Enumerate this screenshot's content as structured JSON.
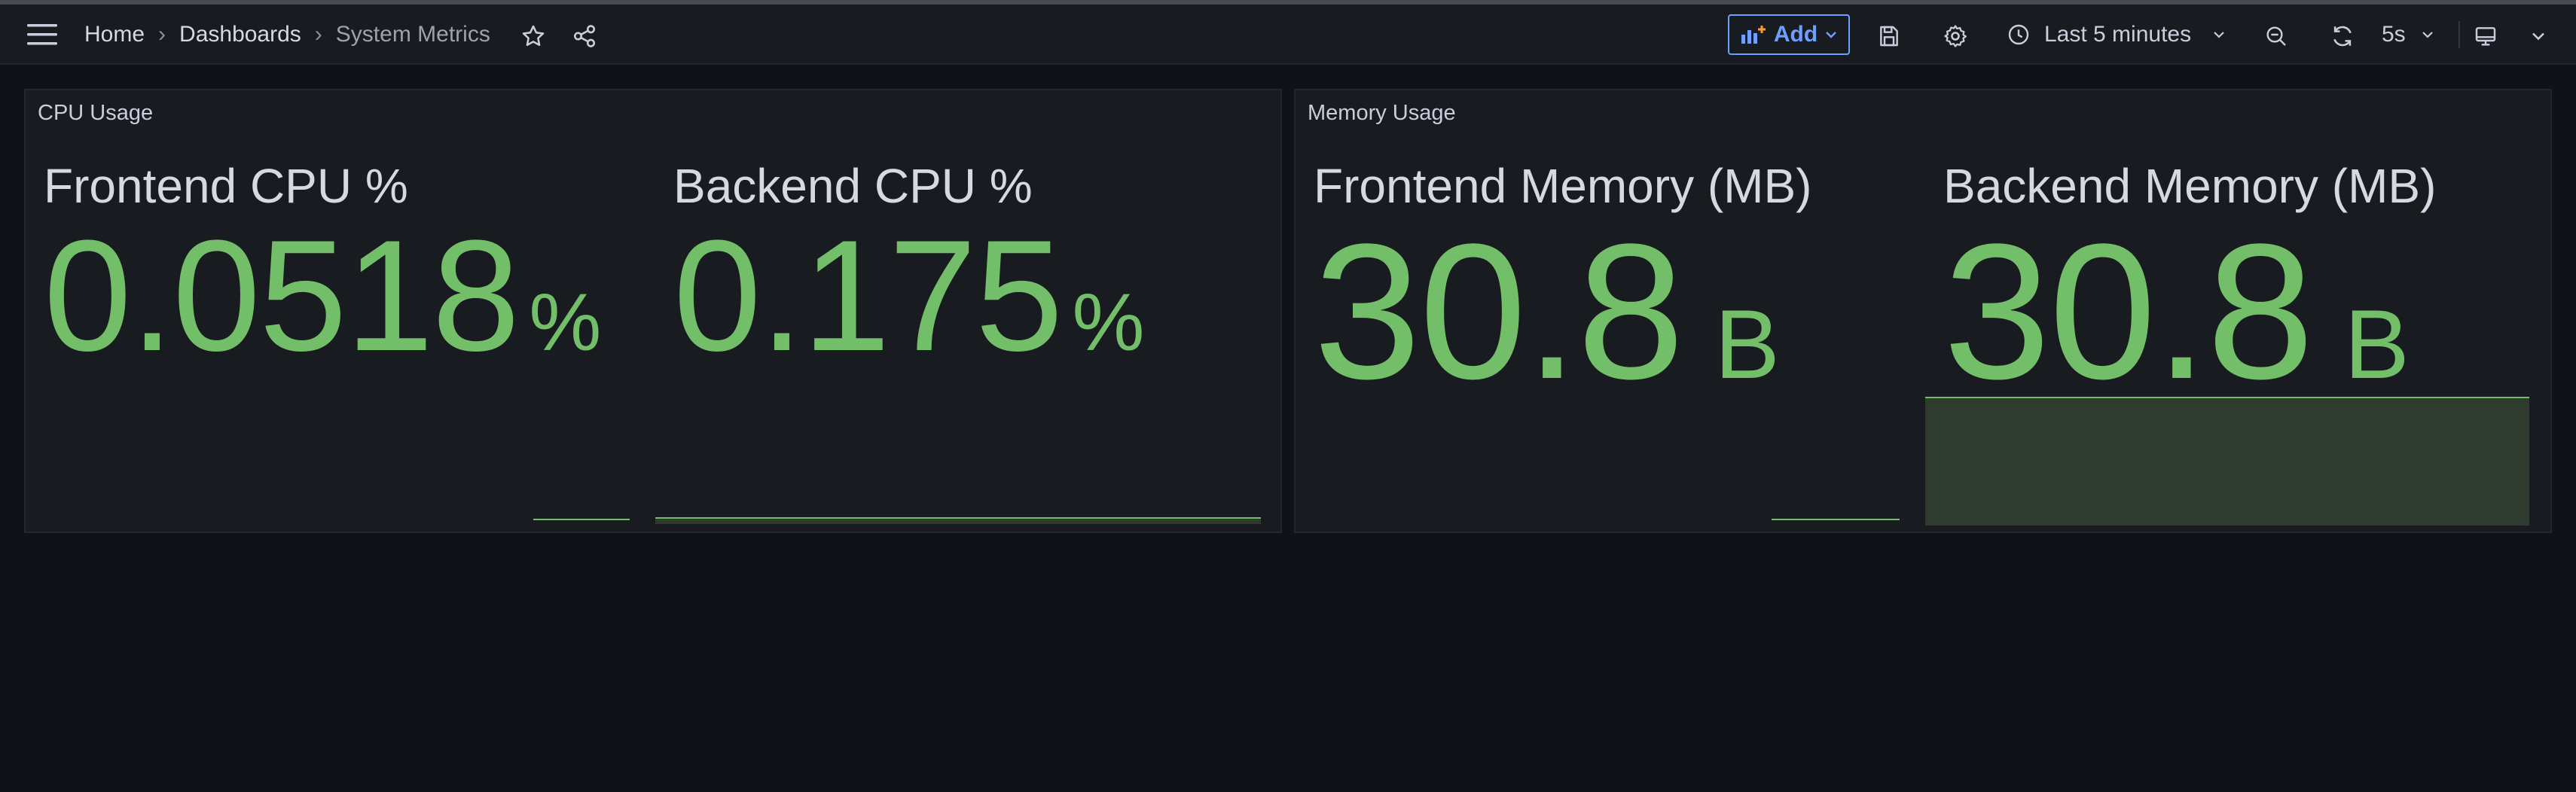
{
  "breadcrumb": {
    "items": [
      "Home",
      "Dashboards",
      "System Metrics"
    ],
    "separator": "›"
  },
  "toolbar": {
    "add_label": "Add",
    "time_range": "Last 5 minutes",
    "refresh_interval": "5s"
  },
  "icons": {
    "menu": "hamburger-menu-icon",
    "star": "star-icon",
    "share": "share-icon",
    "add": "bar-chart-plus-icon",
    "save": "save-icon",
    "settings": "gear-icon",
    "clock": "clock-icon",
    "zoom_out": "zoom-out-icon",
    "refresh": "refresh-icon",
    "tv": "tv-mode-icon",
    "chevron": "chevron-down-icon"
  },
  "colors": {
    "background": "#111217",
    "panel": "#181b1f",
    "accent": "#6e9fff",
    "value_green": "#73bf69"
  },
  "panels": [
    {
      "title": "CPU Usage",
      "stats": [
        {
          "title": "Frontend CPU %",
          "value": "0.0518",
          "unit": "%"
        },
        {
          "title": "Backend CPU %",
          "value": "0.175",
          "unit": "%"
        }
      ]
    },
    {
      "title": "Memory Usage",
      "stats": [
        {
          "title": "Frontend Memory (MB)",
          "value": "30.8",
          "unit": "B"
        },
        {
          "title": "Backend Memory (MB)",
          "value": "30.8",
          "unit": "B"
        }
      ]
    }
  ]
}
